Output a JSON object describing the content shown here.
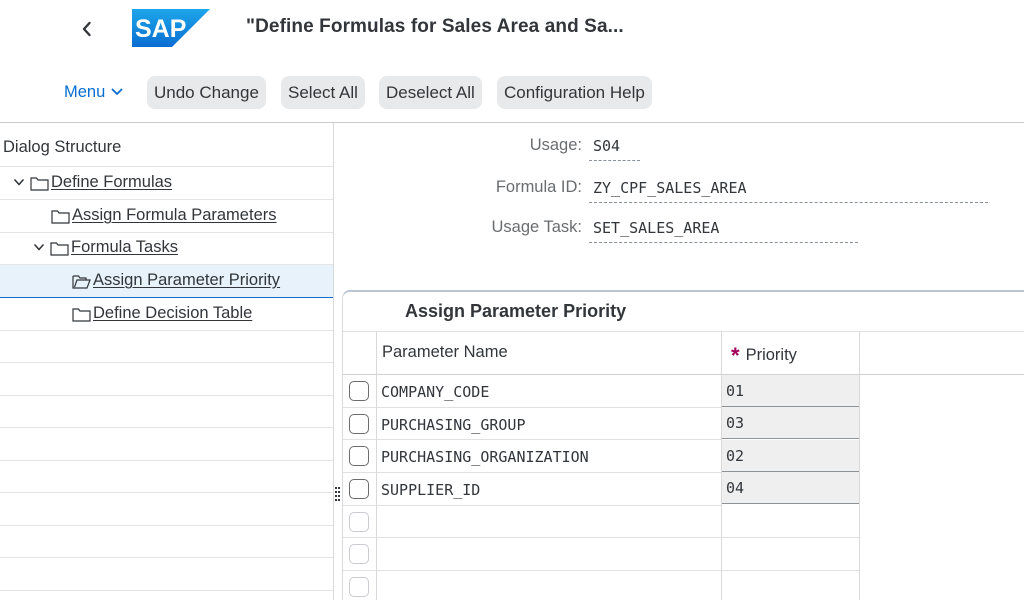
{
  "header": {
    "title": "\"Define Formulas for Sales Area and Sa...",
    "logo_text": "SAP"
  },
  "toolbar": {
    "menu_label": "Menu",
    "buttons": [
      {
        "label": "Undo Change"
      },
      {
        "label": "Select All"
      },
      {
        "label": "Deselect All"
      },
      {
        "label": "Configuration Help"
      }
    ]
  },
  "tree": {
    "title": "Dialog Structure",
    "items": [
      {
        "label": "Define Formulas",
        "expanded": true,
        "level": 1
      },
      {
        "label": "Assign Formula Parameters",
        "level": 2
      },
      {
        "label": "Formula Tasks",
        "expanded": true,
        "level": 2
      },
      {
        "label": "Assign Parameter Priority",
        "level": 3,
        "selected": true
      },
      {
        "label": "Define Decision Table",
        "level": 3
      }
    ]
  },
  "form": {
    "usage_label": "Usage:",
    "usage_value": "S04",
    "formula_id_label": "Formula ID:",
    "formula_id_value": "ZY_CPF_SALES_AREA",
    "usage_task_label": "Usage Task:",
    "usage_task_value": "SET_SALES_AREA"
  },
  "table": {
    "title": "Assign Parameter Priority",
    "col_parameter": "Parameter Name",
    "col_priority": "Priority",
    "required_marker": "*",
    "rows": [
      {
        "parameter": "COMPANY_CODE",
        "priority": "01"
      },
      {
        "parameter": "PURCHASING_GROUP",
        "priority": "03"
      },
      {
        "parameter": "PURCHASING_ORGANIZATION",
        "priority": "02"
      },
      {
        "parameter": "SUPPLIER_ID",
        "priority": "04"
      }
    ]
  },
  "colors": {
    "accent": "#0a6ed1",
    "sap_blue": "#0a6ed1",
    "required": "#a0005a"
  }
}
